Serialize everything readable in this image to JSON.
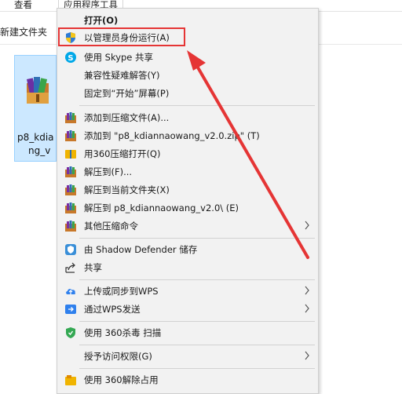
{
  "explorer": {
    "ribbon_tabs": [
      "查看",
      "应用程序工具"
    ],
    "new_folder_label": "新建文件夹",
    "file_label_line1": "p8_kdia",
    "file_label_line2": "ng_v"
  },
  "menu": {
    "items": [
      {
        "label": "打开(O)"
      },
      {
        "label": "以管理员身份运行(A)"
      },
      {
        "label": "使用 Skype 共享"
      },
      {
        "label": "兼容性疑难解答(Y)"
      },
      {
        "label": "固定到“开始”屏幕(P)"
      },
      {
        "label": "添加到压缩文件(A)..."
      },
      {
        "label": "添加到 \"p8_kdiannaowang_v2.0.zip\" (T)"
      },
      {
        "label": "用360压缩打开(Q)"
      },
      {
        "label": "解压到(F)..."
      },
      {
        "label": "解压到当前文件夹(X)"
      },
      {
        "label": "解压到 p8_kdiannaowang_v2.0\\ (E)"
      },
      {
        "label": "其他压缩命令"
      },
      {
        "label": "由 Shadow Defender 储存"
      },
      {
        "label": "共享"
      },
      {
        "label": "上传或同步到WPS"
      },
      {
        "label": "通过WPS发送"
      },
      {
        "label": "使用 360杀毒 扫描"
      },
      {
        "label": "授予访问权限(G)"
      },
      {
        "label": "使用 360解除占用"
      }
    ]
  },
  "colors": {
    "highlight_red": "#e53535",
    "menu_bg": "#f2f2f2",
    "selection_blue": "#cce8ff"
  }
}
